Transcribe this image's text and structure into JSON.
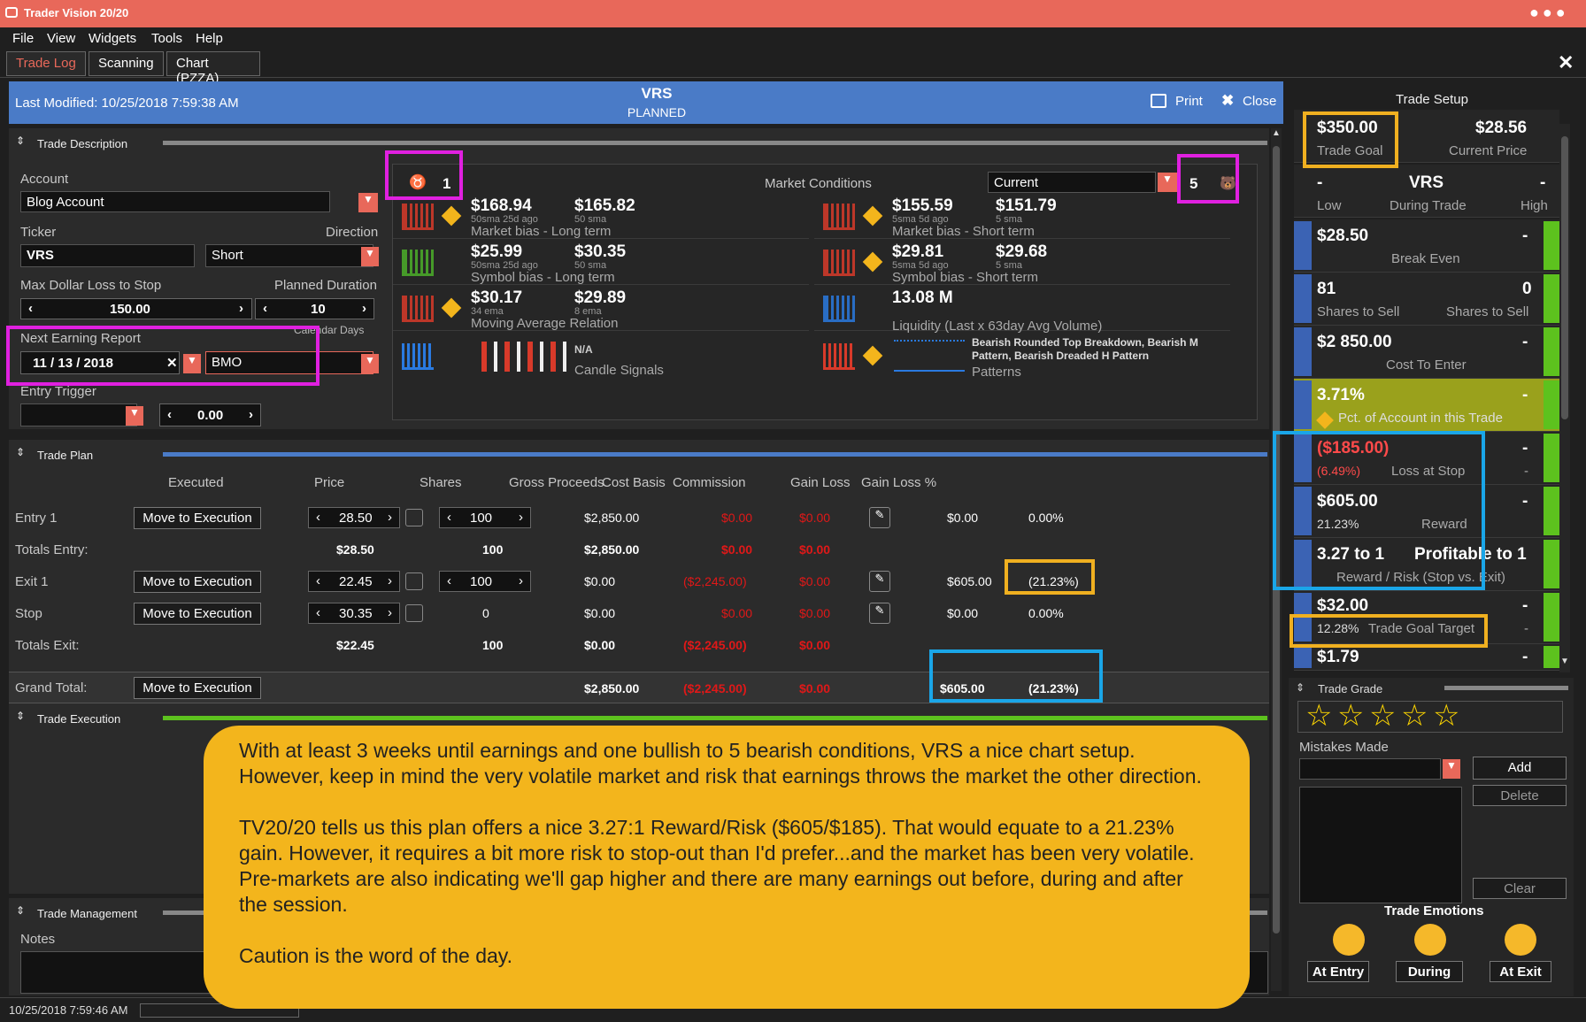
{
  "app": {
    "title": "Trader Vision 20/20"
  },
  "menu": [
    "File",
    "View",
    "Widgets",
    "Tools",
    "Help"
  ],
  "tabs": [
    "Trade Log",
    "Scanning",
    "Chart (PZZA)"
  ],
  "banner": {
    "last_modified": "Last Modified: 10/25/2018 7:59:38 AM",
    "symbol": "VRS",
    "status": "PLANNED",
    "print": "Print",
    "close": "Close"
  },
  "trade_description": {
    "title": "Trade Description",
    "account_label": "Account",
    "account": "Blog Account",
    "ticker_label": "Ticker",
    "ticker": "VRS",
    "direction_label": "Direction",
    "direction": "Short",
    "max_loss_label": "Max Dollar Loss to Stop",
    "max_loss": "150.00",
    "duration_label": "Planned Duration",
    "duration": "10",
    "calendar_days": "Calendar Days",
    "next_earning_label": "Next Earning Report",
    "next_earning_date": "11 / 13 / 2018",
    "earning_time": "BMO",
    "entry_trigger_label": "Entry Trigger",
    "entry_trigger_value": "0.00"
  },
  "market": {
    "bull_count": "1",
    "title": "Market Conditions",
    "select": "Current",
    "bear_count": "5",
    "cells": [
      {
        "v1": "$168.94",
        "s1": "50sma 25d ago",
        "v2": "$165.82",
        "s2": "50 sma",
        "cap": "Market bias - Long term"
      },
      {
        "v1": "$155.59",
        "s1": "5sma 5d ago",
        "v2": "$151.79",
        "s2": "5 sma",
        "cap": "Market bias - Short term"
      },
      {
        "v1": "$25.99",
        "s1": "50sma 25d ago",
        "v2": "$30.35",
        "s2": "50 sma",
        "cap": "Symbol bias - Long term"
      },
      {
        "v1": "$29.81",
        "s1": "5sma 5d ago",
        "v2": "$29.68",
        "s2": "5 sma",
        "cap": "Symbol bias - Short term"
      },
      {
        "v1": "$30.17",
        "s1": "34 ema",
        "v2": "$29.89",
        "s2": "8 ema",
        "cap": "Moving Average Relation"
      },
      {
        "v1": "13.08 M",
        "s1": "",
        "v2": "",
        "s2": "",
        "cap": "Liquidity (Last x 63day Avg Volume)"
      }
    ],
    "candle_value": "N/A",
    "candle_caption": "Candle Signals",
    "patterns_text": "Bearish Rounded Top Breakdown, Bearish M Pattern, Bearish Dreaded H Pattern",
    "patterns_caption": "Patterns"
  },
  "trade_plan": {
    "title": "Trade Plan",
    "headers": [
      "Executed",
      "Price",
      "Shares",
      "Gross Proceeds",
      "Cost Basis",
      "Commission",
      "Gain Loss",
      "Gain Loss %"
    ],
    "move_btn": "Move to Execution",
    "entry1": {
      "label": "Entry 1",
      "price": "28.50",
      "shares": "100",
      "gross": "$2,850.00",
      "cost": "$0.00",
      "comm": "$0.00",
      "gain": "$0.00",
      "pct": "0.00%"
    },
    "totals_entry": {
      "label": "Totals Entry:",
      "price": "$28.50",
      "shares": "100",
      "gross": "$2,850.00",
      "cost": "$0.00",
      "comm": "$0.00"
    },
    "exit1": {
      "label": "Exit 1",
      "price": "22.45",
      "shares": "100",
      "gross": "$0.00",
      "cost": "($2,245.00)",
      "comm": "$0.00",
      "gain": "$605.00",
      "pct": "(21.23%)"
    },
    "stop": {
      "label": "Stop",
      "price": "30.35",
      "shares": "0",
      "gross": "$0.00",
      "cost": "$0.00",
      "comm": "$0.00",
      "gain": "$0.00",
      "pct": "0.00%"
    },
    "totals_exit": {
      "label": "Totals Exit:",
      "price": "$22.45",
      "shares": "100",
      "gross": "$0.00",
      "cost": "($2,245.00)",
      "comm": "$0.00"
    },
    "grand": {
      "label": "Grand Total:",
      "gross": "$2,850.00",
      "cost": "($2,245.00)",
      "comm": "$0.00",
      "gain": "$605.00",
      "pct": "(21.23%)"
    }
  },
  "trade_execution": {
    "title": "Trade Execution"
  },
  "trade_management": {
    "title": "Trade Management",
    "notes_label": "Notes"
  },
  "status_time": "10/25/2018 7:59:46 AM",
  "setup": {
    "title": "Trade Setup",
    "goal": "$350.00",
    "goal_lbl": "Trade Goal",
    "cur": "$28.56",
    "cur_lbl": "Current Price",
    "low": "-",
    "low_lbl": "Low",
    "sym": "VRS",
    "during_lbl": "During Trade",
    "high": "-",
    "high_lbl": "High",
    "be": "$28.50",
    "be_r": "-",
    "be_lbl": "Break Even",
    "sh1": "81",
    "sh1_lbl": "Shares to Sell",
    "sh2": "0",
    "sh2_lbl": "Shares to Sell",
    "cost": "$2 850.00",
    "cost_r": "-",
    "cost_lbl": "Cost To Enter",
    "pct": "3.71%",
    "pct_r": "-",
    "pct_lbl": "Pct. of Account in this Trade",
    "loss": "($185.00)",
    "loss_r": "-",
    "loss_pct": "(6.49%)",
    "loss_lbl": "Loss at Stop",
    "loss_r2": "-",
    "rew": "$605.00",
    "rew_r": "-",
    "rew_pct": "21.23%",
    "rew_lbl": "Reward",
    "rr": "3.27 to 1",
    "rr2": "Profitable to 1",
    "rr_lbl": "Reward / Risk (Stop vs. Exit)",
    "tgt": "$32.00",
    "tgt_r": "-",
    "tgt_pct": "12.28%",
    "tgt_lbl": "Trade Goal Target",
    "tgt_r2": "-",
    "last": "$1.79",
    "last_r": "-"
  },
  "grade": {
    "title": "Trade Grade",
    "mistakes": "Mistakes Made",
    "add": "Add",
    "delete": "Delete",
    "clear": "Clear",
    "emotions": "Trade Emotions",
    "at_entry": "At Entry",
    "during": "During",
    "at_exit": "At Exit"
  },
  "note": {
    "p1": "With at least 3 weeks until earnings and one bullish to 5 bearish conditions, VRS a nice chart setup. However, keep in mind the very volatile market and risk that earnings throws the market the other direction.",
    "p2": "TV20/20 tells us this plan offers a nice 3.27:1 Reward/Risk ($605/$185).  That would equate to a 21.23% gain.  However, it requires a bit more risk to stop-out than I'd prefer...and the market has been very volatile.  Pre-markets are also indicating we'll gap higher and there are many earnings out before, during and after the session.",
    "p3": "Caution is the word of the day."
  },
  "colors": {
    "title": "#e8685a",
    "banner": "#4a7bc7",
    "note": "#f3b51c",
    "bull": "#4caf2a",
    "bear": "#d83a2a",
    "green_bar": "#5dc21e",
    "blue_bar": "#3b63b4"
  }
}
